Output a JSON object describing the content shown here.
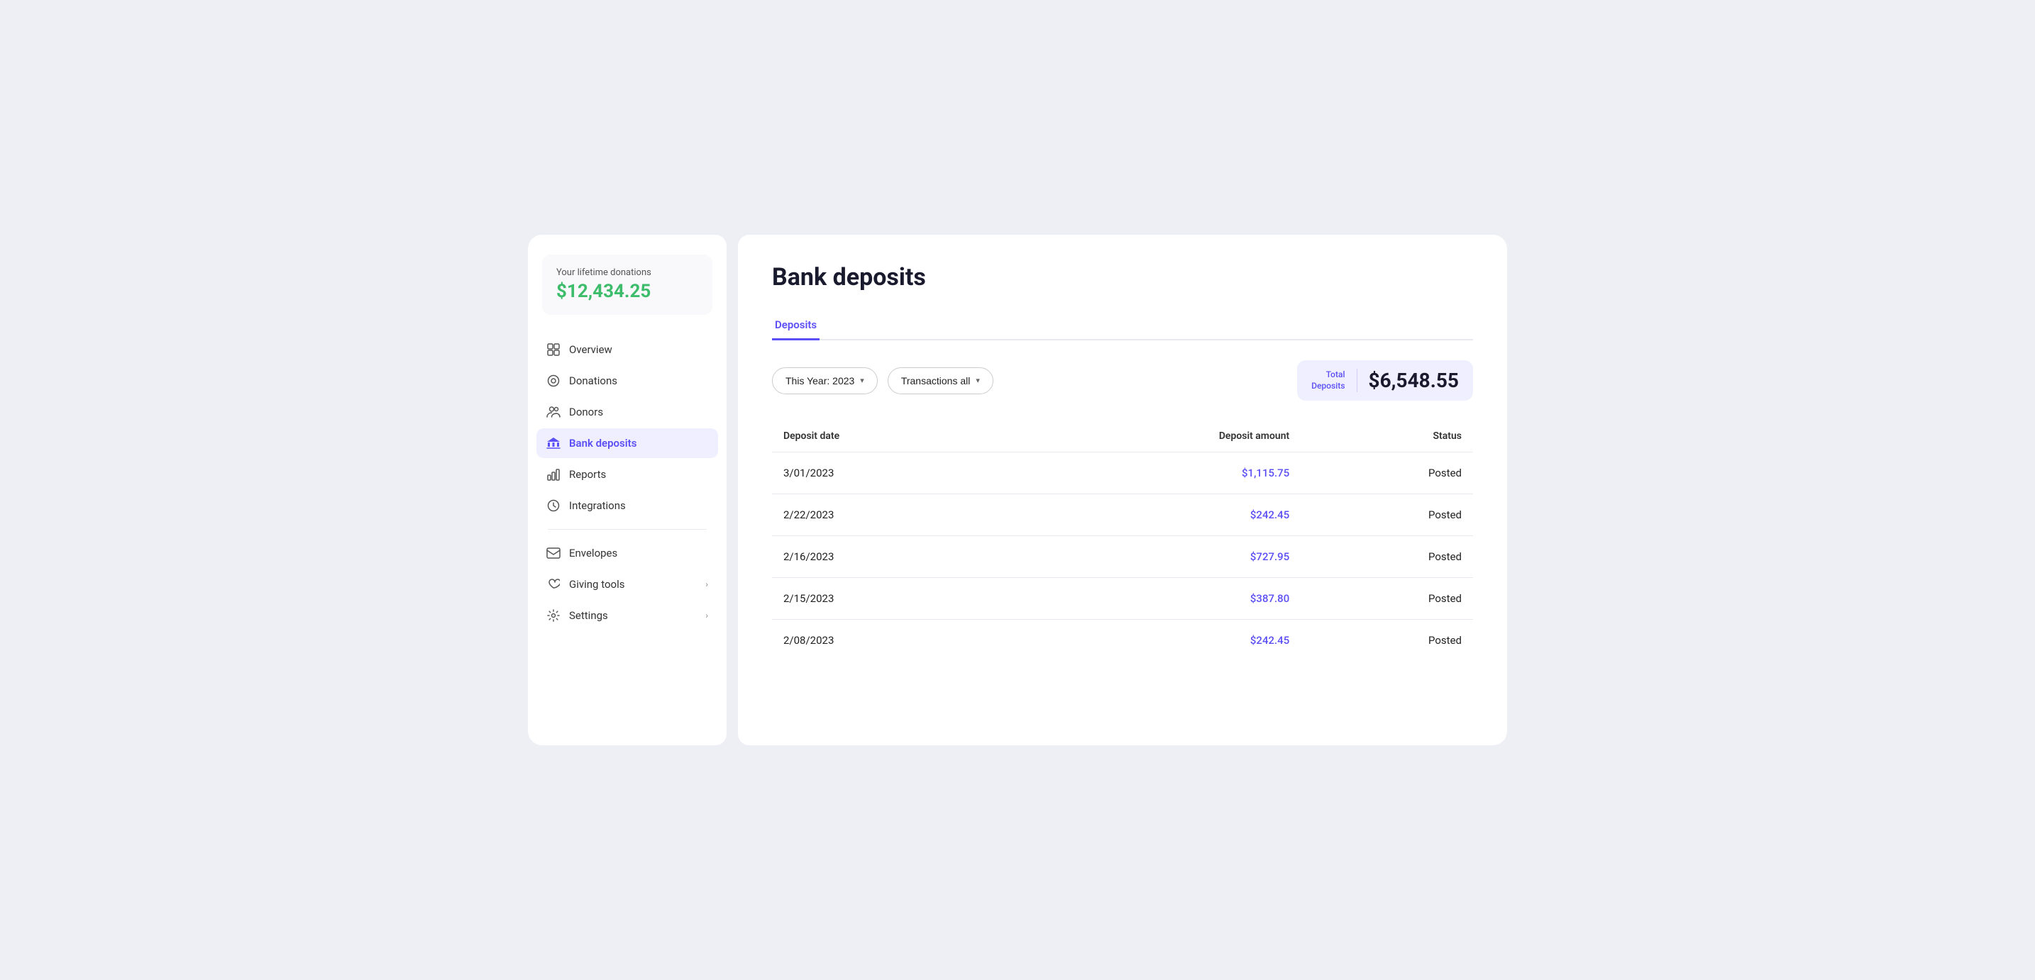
{
  "sidebar": {
    "lifetime_label": "Your lifetime donations",
    "lifetime_amount": "$12,434.25",
    "nav_items": [
      {
        "id": "overview",
        "label": "Overview",
        "icon": "grid",
        "active": false,
        "has_chevron": false
      },
      {
        "id": "donations",
        "label": "Donations",
        "icon": "circle-dash",
        "active": false,
        "has_chevron": false
      },
      {
        "id": "donors",
        "label": "Donors",
        "icon": "people",
        "active": false,
        "has_chevron": false
      },
      {
        "id": "bank-deposits",
        "label": "Bank deposits",
        "icon": "bank",
        "active": true,
        "has_chevron": false
      },
      {
        "id": "reports",
        "label": "Reports",
        "icon": "chart",
        "active": false,
        "has_chevron": false
      },
      {
        "id": "integrations",
        "label": "Integrations",
        "icon": "integrations",
        "active": false,
        "has_chevron": false
      },
      {
        "id": "envelopes",
        "label": "Envelopes",
        "icon": "envelopes",
        "active": false,
        "has_chevron": false
      },
      {
        "id": "giving-tools",
        "label": "Giving tools",
        "icon": "giving",
        "active": false,
        "has_chevron": true
      },
      {
        "id": "settings",
        "label": "Settings",
        "icon": "settings",
        "active": false,
        "has_chevron": true
      }
    ]
  },
  "main": {
    "page_title": "Bank deposits",
    "tabs": [
      {
        "id": "deposits",
        "label": "Deposits",
        "active": true
      }
    ],
    "filters": {
      "year_filter": "This Year: 2023",
      "transactions_filter": "Transactions all"
    },
    "total_deposits_label": "Total\nDeposits",
    "total_deposits_amount": "$6,548.55",
    "table": {
      "headers": {
        "date": "Deposit date",
        "amount": "Deposit amount",
        "status": "Status"
      },
      "rows": [
        {
          "date": "3/01/2023",
          "amount": "$1,115.75",
          "status": "Posted"
        },
        {
          "date": "2/22/2023",
          "amount": "$242.45",
          "status": "Posted"
        },
        {
          "date": "2/16/2023",
          "amount": "$727.95",
          "status": "Posted"
        },
        {
          "date": "2/15/2023",
          "amount": "$387.80",
          "status": "Posted"
        },
        {
          "date": "2/08/2023",
          "amount": "$242.45",
          "status": "Posted"
        }
      ]
    }
  }
}
